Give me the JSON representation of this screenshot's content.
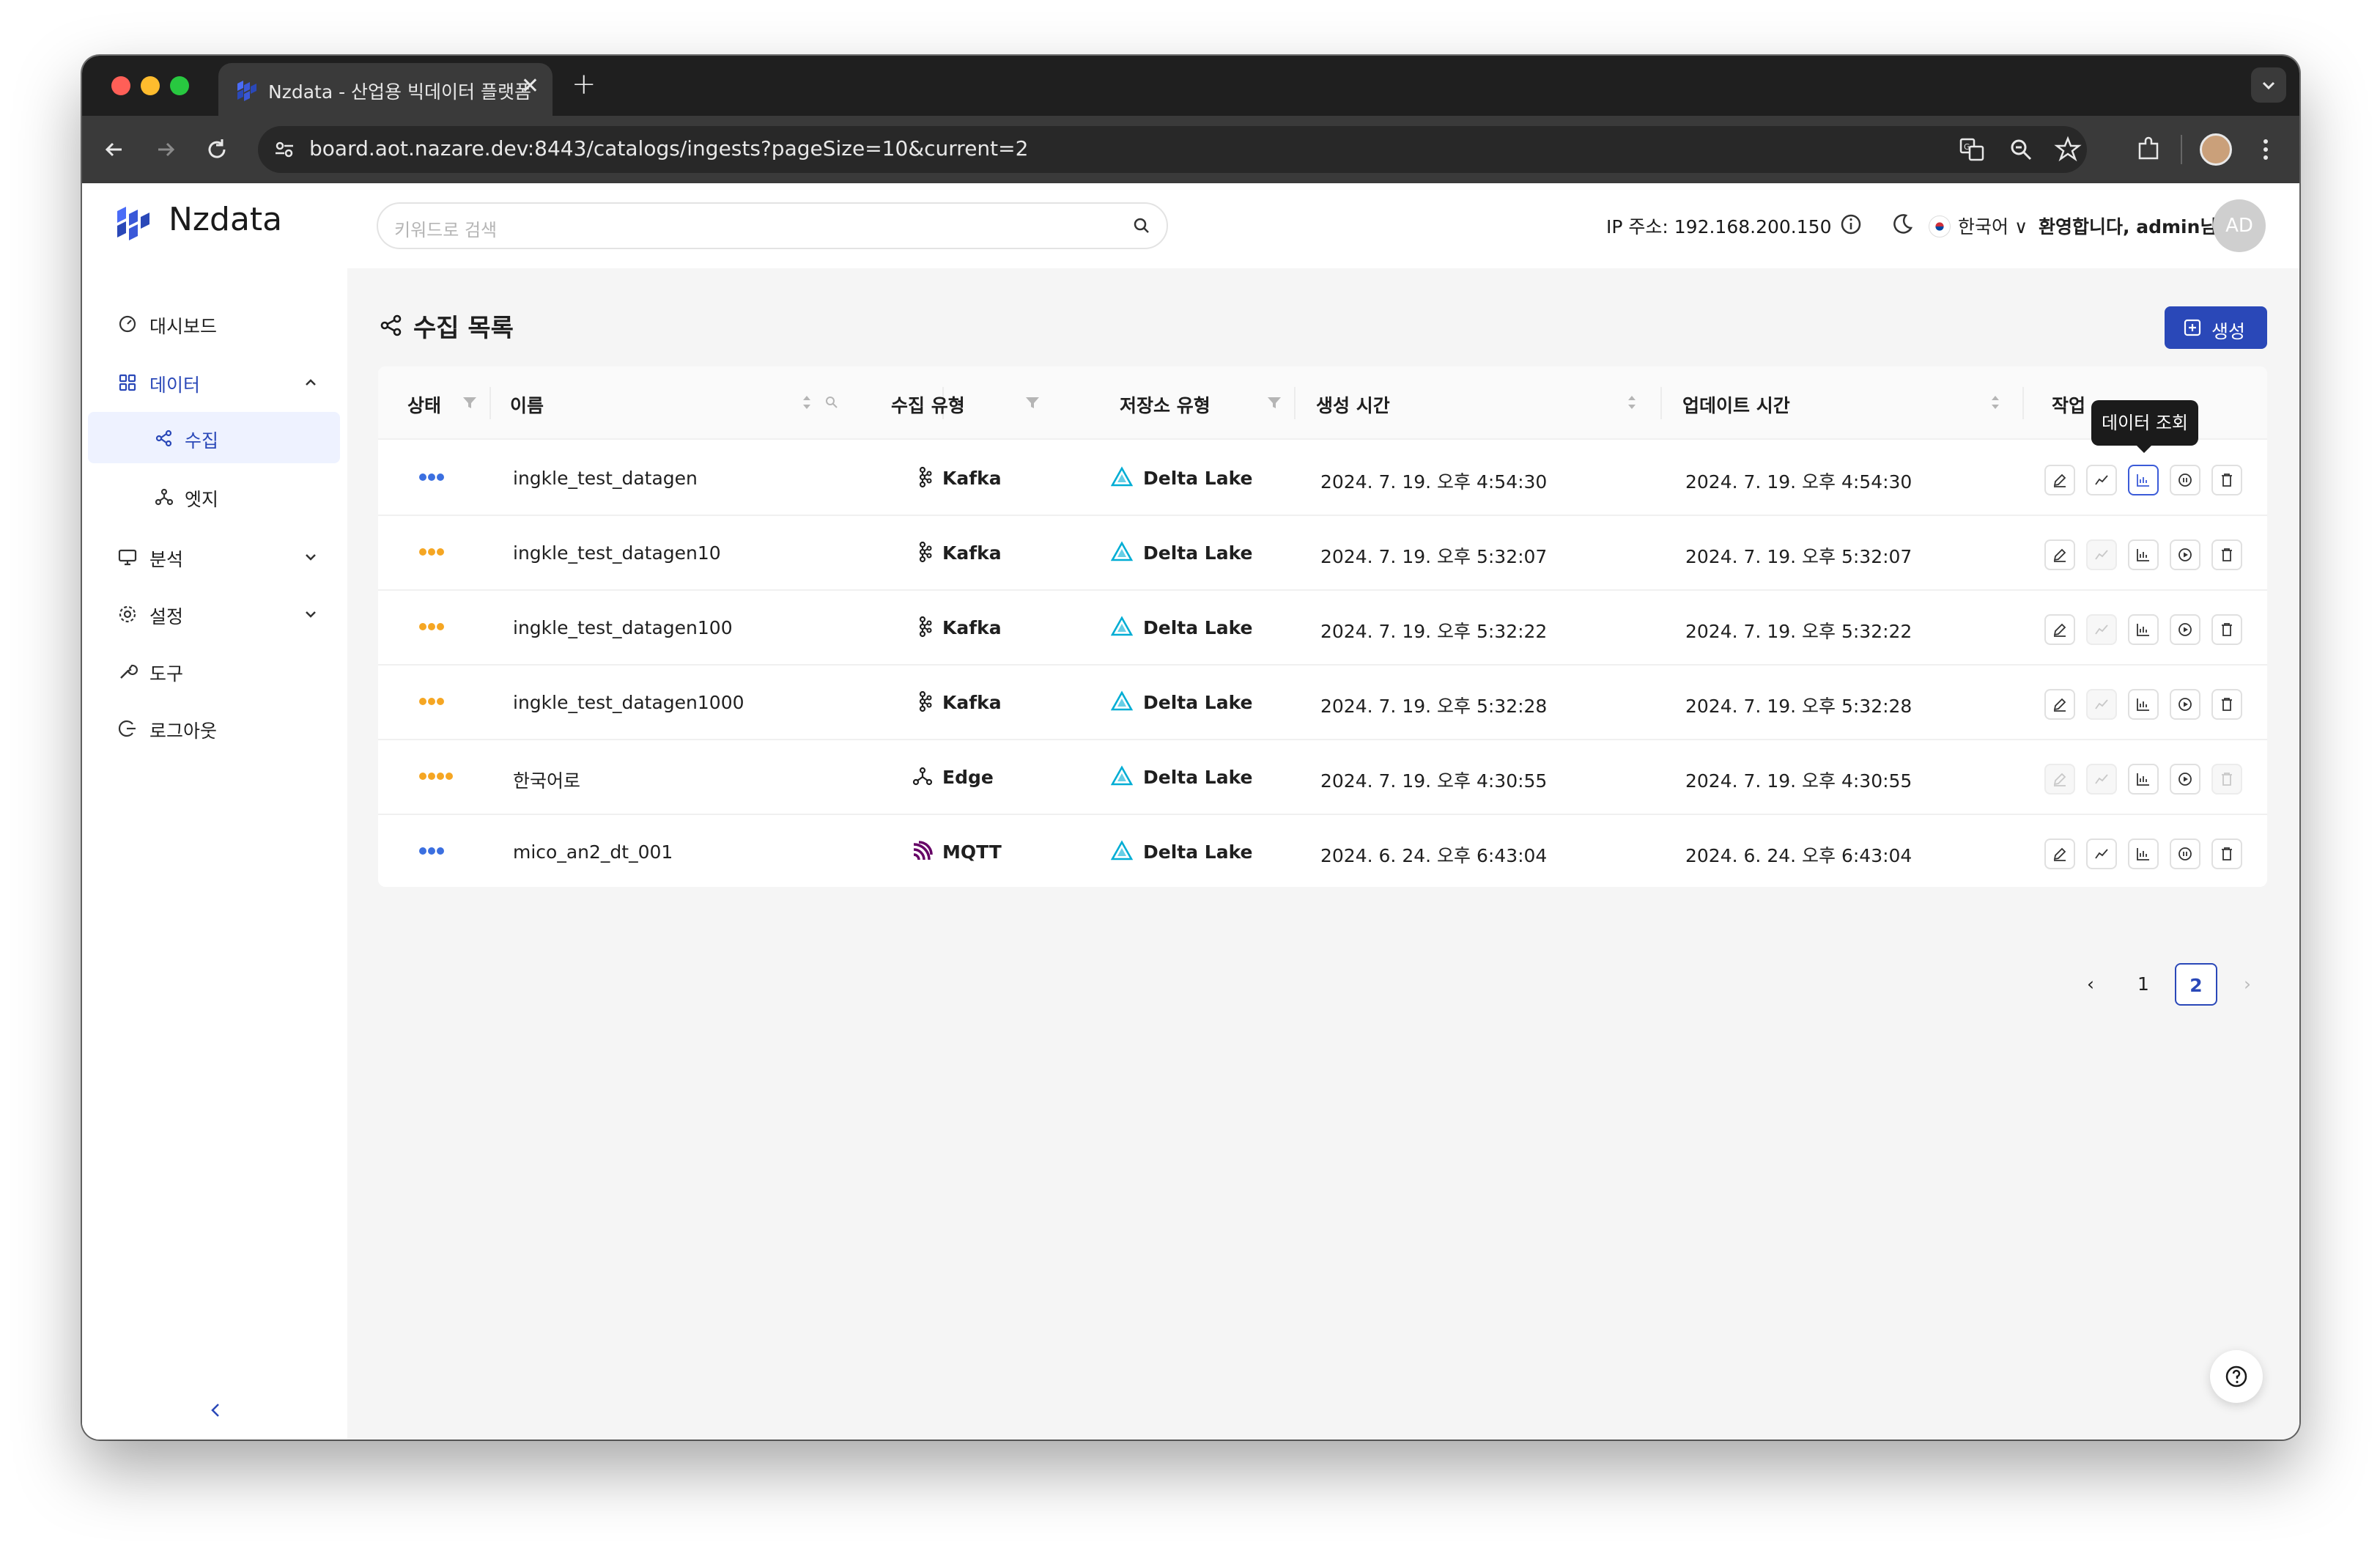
{
  "browser": {
    "tab_title": "Nzdata - 산업용 빅데이터 플랫폼",
    "new_tab": "+",
    "close": "✕",
    "url": "board.aot.nazare.dev:8443/catalogs/ingests?pageSize=10&current=2"
  },
  "header": {
    "logo": "Nzdata",
    "search_placeholder": "키워드로 검색",
    "ip": "IP 주소: 192.168.200.150",
    "language": "한국어 ∨",
    "welcome": "환영합니다, admin님",
    "avatar": "AD"
  },
  "sidebar": {
    "items": [
      {
        "label": "대시보드",
        "icon": "dashboard-icon"
      },
      {
        "label": "데이터",
        "icon": "grid-icon",
        "active": true
      },
      {
        "label": "수집",
        "icon": "share-icon",
        "sub": true,
        "active": true
      },
      {
        "label": "엣지",
        "icon": "edge-icon",
        "sub": true
      },
      {
        "label": "분석",
        "icon": "monitor-icon"
      },
      {
        "label": "설정",
        "icon": "gear-icon"
      },
      {
        "label": "도구",
        "icon": "tool-icon"
      },
      {
        "label": "로그아웃",
        "icon": "logout-icon"
      }
    ]
  },
  "page": {
    "title": "수집 목록",
    "create_label": "생성",
    "tooltip": "데이터 조회"
  },
  "table": {
    "columns": [
      "상태",
      "이름",
      "수집 유형",
      "저장소 유형",
      "생성 시간",
      "업데이트 시간",
      "작업"
    ],
    "rows": [
      {
        "status": "running",
        "dots": 3,
        "name": "ingkle_test_datagen",
        "ingest_type": "Kafka",
        "storage_type": "Delta Lake",
        "created": "2024. 7. 19. 오후 4:54:30",
        "updated": "2024. 7. 19. 오후 4:54:30"
      },
      {
        "status": "stopped",
        "dots": 3,
        "name": "ingkle_test_datagen10",
        "ingest_type": "Kafka",
        "storage_type": "Delta Lake",
        "created": "2024. 7. 19. 오후 5:32:07",
        "updated": "2024. 7. 19. 오후 5:32:07"
      },
      {
        "status": "stopped",
        "dots": 3,
        "name": "ingkle_test_datagen100",
        "ingest_type": "Kafka",
        "storage_type": "Delta Lake",
        "created": "2024. 7. 19. 오후 5:32:22",
        "updated": "2024. 7. 19. 오후 5:32:22"
      },
      {
        "status": "stopped",
        "dots": 3,
        "name": "ingkle_test_datagen1000",
        "ingest_type": "Kafka",
        "storage_type": "Delta Lake",
        "created": "2024. 7. 19. 오후 5:32:28",
        "updated": "2024. 7. 19. 오후 5:32:28"
      },
      {
        "status": "stopped",
        "dots": 4,
        "name": "한국어로",
        "ingest_type": "Edge",
        "storage_type": "Delta Lake",
        "created": "2024. 7. 19. 오후 4:30:55",
        "updated": "2024. 7. 19. 오후 4:30:55"
      },
      {
        "status": "running",
        "dots": 3,
        "name": "mico_an2_dt_001",
        "ingest_type": "MQTT",
        "storage_type": "Delta Lake",
        "created": "2024. 6. 24. 오후 6:43:04",
        "updated": "2024. 6. 24. 오후 6:43:04"
      }
    ]
  },
  "pagination": {
    "prev": "‹",
    "pages": [
      "1",
      "2"
    ],
    "current": "2",
    "next": "›"
  },
  "colors": {
    "primary": "#2a48b8",
    "running": "#3b6fe0",
    "stopped": "#f5a623",
    "kafka": "#1f1f1f",
    "mqtt": "#660066",
    "delta": "#00add4"
  }
}
